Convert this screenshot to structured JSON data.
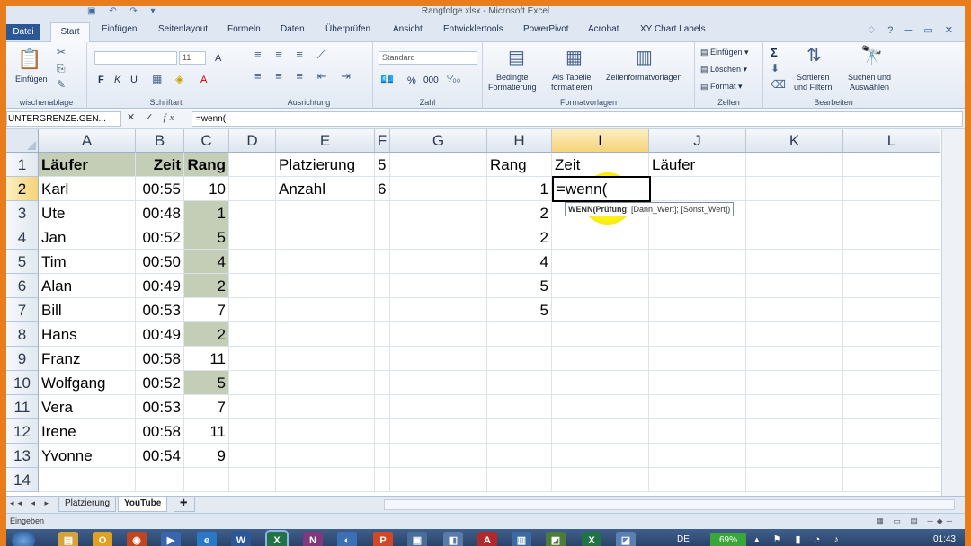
{
  "window": {
    "title": "Rangfolge.xlsx - Microsoft Excel"
  },
  "tabs": {
    "file": "Datei",
    "items": [
      "Start",
      "Einfügen",
      "Seitenlayout",
      "Formeln",
      "Daten",
      "Überprüfen",
      "Ansicht",
      "Entwicklertools",
      "PowerPivot",
      "Acrobat",
      "XY Chart Labels"
    ]
  },
  "ribbon": {
    "clipboard": {
      "paste": "Einfügen",
      "group": "wischenablage"
    },
    "font": {
      "name": "",
      "size": "11",
      "bold": "F",
      "italic": "K",
      "underline": "U",
      "grow": "A",
      "shrink": "A",
      "group": "Schriftart"
    },
    "alignment": {
      "group": "Ausrichtung"
    },
    "number": {
      "format": "Standard",
      "percent": "%",
      "thousands": "000",
      "group": "Zahl"
    },
    "styles": {
      "conditional": "Bedingte\nFormatierung",
      "as_table": "Als Tabelle\nformatieren",
      "cell_styles": "Zellenformatvorlagen",
      "group": "Formatvorlagen"
    },
    "cells": {
      "insert": "Einfügen",
      "delete": "Löschen",
      "format": "Format",
      "group": "Zellen"
    },
    "editing": {
      "sum": "Σ",
      "sort": "Sortieren\nund Filtern",
      "find": "Suchen und\nAuswählen",
      "group": "Bearbeiten"
    }
  },
  "formula_bar": {
    "name_box": "UNTERGRENZE.GEN...",
    "cancel": "✕",
    "enter": "✓",
    "fx": "fx",
    "formula": "=wenn("
  },
  "columns": [
    "A",
    "B",
    "C",
    "D",
    "E",
    "F",
    "G",
    "H",
    "I",
    "J",
    "K",
    "L"
  ],
  "rows": [
    "1",
    "2",
    "3",
    "4",
    "5",
    "6",
    "7",
    "8",
    "9",
    "10",
    "11",
    "12",
    "13",
    "14"
  ],
  "table": {
    "headers": {
      "a": "Läufer",
      "b": "Zeit",
      "c": "Rang"
    },
    "records": [
      {
        "name": "Karl",
        "time": "00:55",
        "rank": "10",
        "hl": false
      },
      {
        "name": "Ute",
        "time": "00:48",
        "rank": "1",
        "hl": true
      },
      {
        "name": "Jan",
        "time": "00:52",
        "rank": "5",
        "hl": true
      },
      {
        "name": "Tim",
        "time": "00:50",
        "rank": "4",
        "hl": true
      },
      {
        "name": "Alan",
        "time": "00:49",
        "rank": "2",
        "hl": true
      },
      {
        "name": "Bill",
        "time": "00:53",
        "rank": "7",
        "hl": false
      },
      {
        "name": "Hans",
        "time": "00:49",
        "rank": "2",
        "hl": true
      },
      {
        "name": "Franz",
        "time": "00:58",
        "rank": "11",
        "hl": false
      },
      {
        "name": "Wolfgang",
        "time": "00:52",
        "rank": "5",
        "hl": true
      },
      {
        "name": "Vera",
        "time": "00:53",
        "rank": "7",
        "hl": false
      },
      {
        "name": "Irene",
        "time": "00:58",
        "rank": "11",
        "hl": false
      },
      {
        "name": "Yvonne",
        "time": "00:54",
        "rank": "9",
        "hl": false
      }
    ]
  },
  "params": {
    "placement_label": "Platzierung",
    "placement_value": "5",
    "count_label": "Anzahl",
    "count_value": "6"
  },
  "result": {
    "rank_header": "Rang",
    "time_header": "Zeit",
    "runner_header": "Läufer",
    "ranks": [
      "1",
      "2",
      "2",
      "4",
      "5",
      "5"
    ]
  },
  "active_cell": {
    "ref": "I2",
    "content": "=wenn("
  },
  "tooltip": {
    "bold": "WENN(Prüfung",
    "rest": "; [Dann_Wert]; [Sonst_Wert])"
  },
  "sheets": {
    "tabs": [
      "Platzierung",
      "YouTube"
    ],
    "active": "YouTube"
  },
  "status": {
    "mode": "Eingeben"
  },
  "taskbar": {
    "language": "DE",
    "battery": "69%",
    "clock": "01:43"
  },
  "colors": {
    "accent": "#e87d1e",
    "highlight": "#c4cdb5",
    "file_tab": "#2b5797",
    "marker": "#fff200"
  }
}
